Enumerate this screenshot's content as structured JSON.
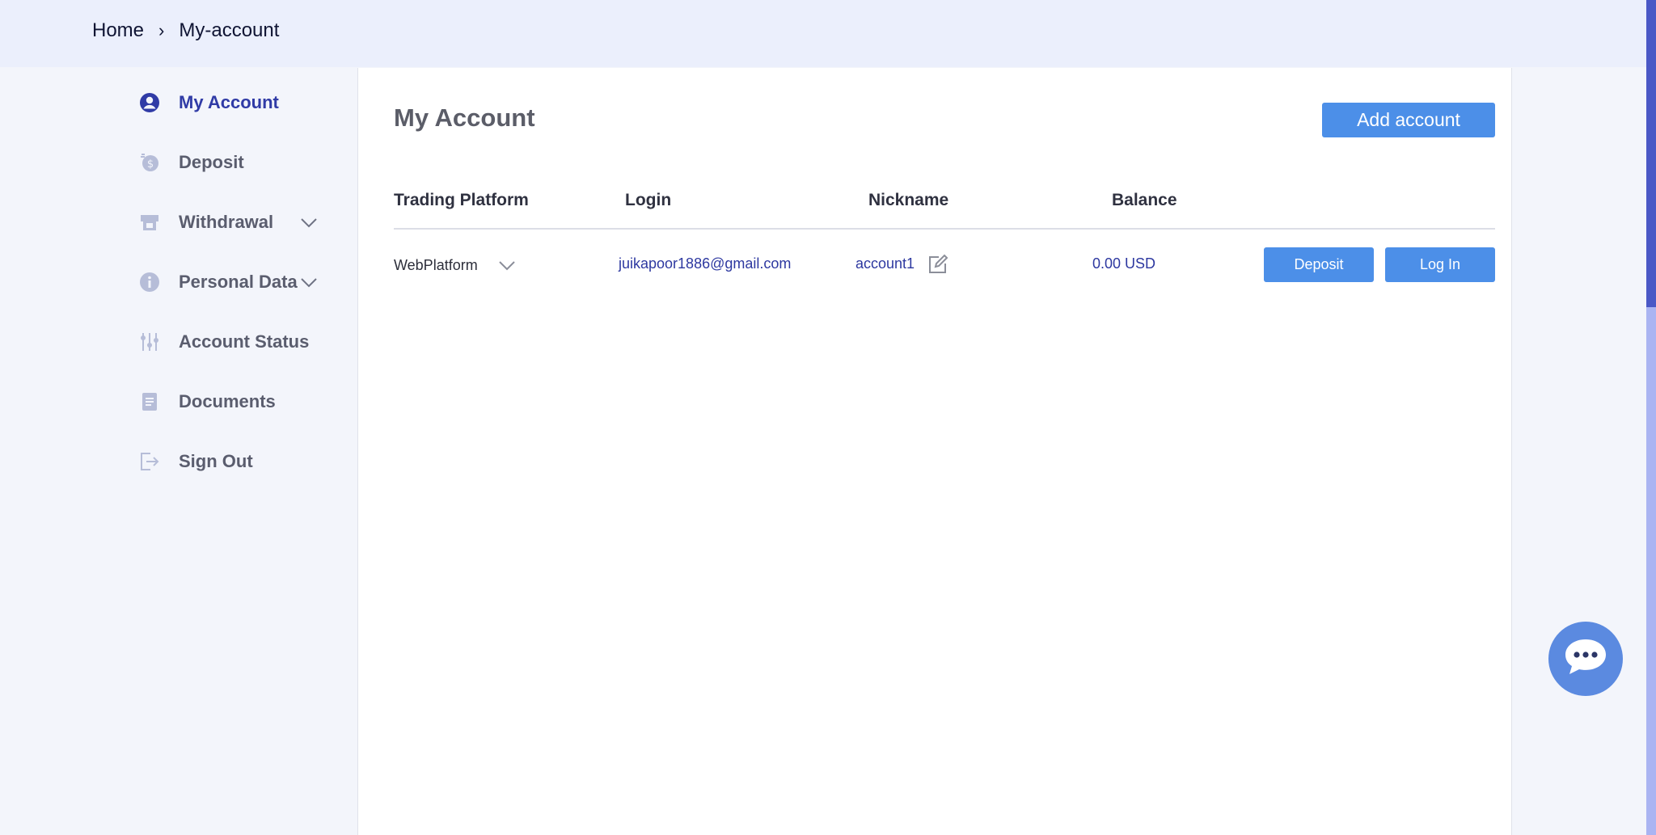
{
  "breadcrumb": {
    "home": "Home",
    "separator": "›",
    "current": "My-account"
  },
  "sidebar": {
    "items": [
      {
        "label": "My Account",
        "icon": "user-circle-icon",
        "active": true
      },
      {
        "label": "Deposit",
        "icon": "dollar-coin-icon"
      },
      {
        "label": "Withdrawal",
        "icon": "atm-icon",
        "expandable": true
      },
      {
        "label": "Personal Data",
        "icon": "info-icon",
        "expandable": true
      },
      {
        "label": "Account Status",
        "icon": "sliders-icon"
      },
      {
        "label": "Documents",
        "icon": "document-icon"
      },
      {
        "label": "Sign Out",
        "icon": "sign-out-icon"
      }
    ]
  },
  "main": {
    "title": "My Account",
    "add_account_label": "Add account",
    "table": {
      "headers": [
        "Trading Platform",
        "Login",
        "Nickname",
        "Balance"
      ],
      "rows": [
        {
          "platform": "WebPlatform",
          "login": "juikapoor1886@gmail.com",
          "nickname": "account1",
          "balance": "0.00 USD",
          "deposit_label": "Deposit",
          "login_label": "Log In"
        }
      ]
    }
  },
  "colors": {
    "accent": "#4c8fe8",
    "active_nav": "#303ba6",
    "link": "#2d38a0",
    "topbar": "#ebeffc",
    "chat": "#5b8ae0"
  }
}
